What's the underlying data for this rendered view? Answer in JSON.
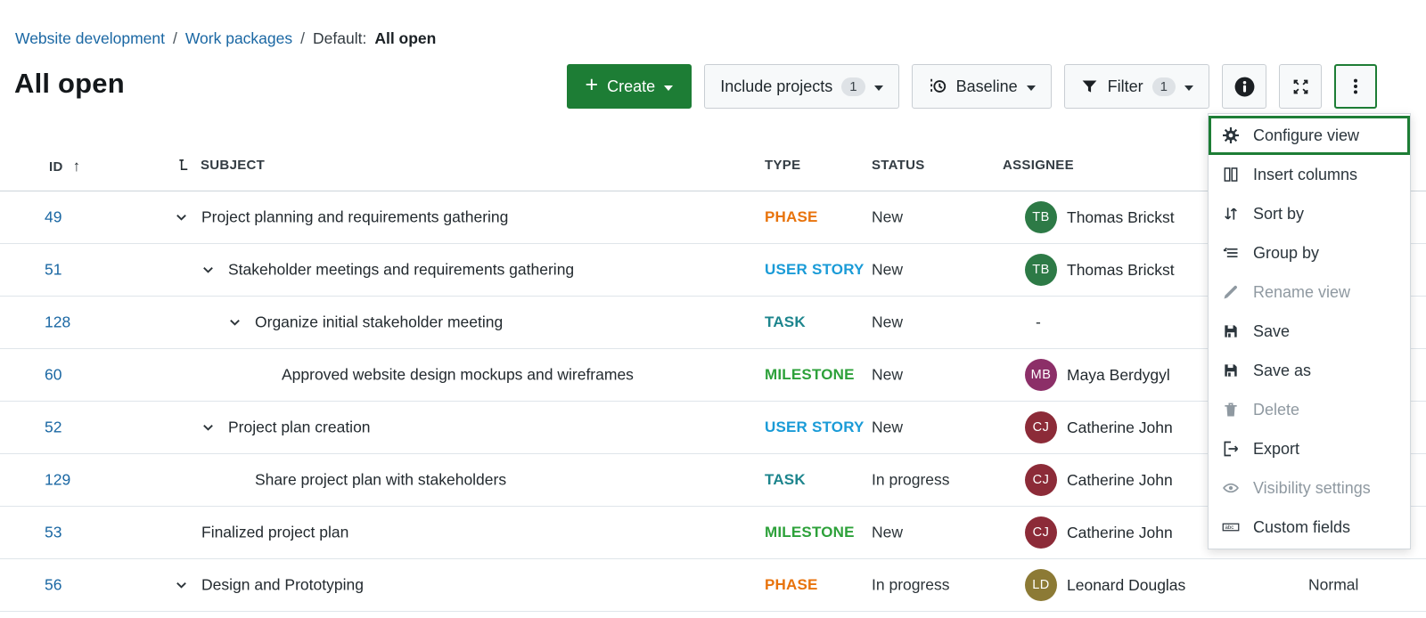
{
  "breadcrumb": {
    "separator": "/",
    "project": "Website development",
    "section": "Work packages",
    "default_prefix": "Default:",
    "current_view": "All open"
  },
  "page": {
    "title": "All open"
  },
  "toolbar": {
    "create_button": {
      "plus": "+",
      "label": "Create"
    },
    "include_projects_button": {
      "label": "Include projects",
      "count": "1"
    },
    "baseline_button": {
      "label": "Baseline",
      "icon": "baseline-clock-icon"
    },
    "filter_button": {
      "label": "Filter",
      "count": "1",
      "icon": "funnel-icon"
    },
    "info_button": {
      "icon": "info-icon"
    },
    "fullscreen_button": {
      "icon": "fullscreen-icon"
    },
    "more_button": {
      "icon": "kebab-menu-icon",
      "state": "focused"
    }
  },
  "menu": {
    "items": [
      {
        "label": "Configure view",
        "icon": "gear-icon",
        "state": "focused"
      },
      {
        "label": "Insert columns",
        "icon": "columns-icon",
        "state": "normal"
      },
      {
        "label": "Sort by",
        "icon": "sort-arrows-icon",
        "state": "normal"
      },
      {
        "label": "Group by",
        "icon": "group-by-icon",
        "state": "normal"
      },
      {
        "label": "Rename view",
        "icon": "pencil-icon",
        "state": "disabled"
      },
      {
        "label": "Save",
        "icon": "save-icon",
        "state": "normal"
      },
      {
        "label": "Save as",
        "icon": "save-icon",
        "state": "normal"
      },
      {
        "label": "Delete",
        "icon": "trash-icon",
        "state": "disabled"
      },
      {
        "label": "Export",
        "icon": "export-icon",
        "state": "normal"
      },
      {
        "label": "Visibility settings",
        "icon": "eye-icon",
        "state": "disabled"
      },
      {
        "label": "Custom fields",
        "icon": "abc-icon",
        "state": "normal"
      }
    ]
  },
  "table": {
    "headers": {
      "id": "ID",
      "subject": "SUBJECT",
      "type": "TYPE",
      "status": "STATUS",
      "assignee": "ASSIGNEE"
    },
    "sort": {
      "column": "ID",
      "direction": "asc",
      "arrow": "↑"
    },
    "rows": [
      {
        "id": "49",
        "level": 1,
        "expanded": true,
        "subject": "Project planning and requirements gathering",
        "type": "PHASE",
        "type_color": "#e8730c",
        "status": "New",
        "assignee": {
          "initials": "TB",
          "name": "Thomas Brickst",
          "color": "#2d7a46"
        }
      },
      {
        "id": "51",
        "level": 2,
        "expanded": true,
        "subject": "Stakeholder meetings and requirements gathering",
        "type": "USER STORY",
        "type_color": "#1a9bd7",
        "status": "New",
        "assignee": {
          "initials": "TB",
          "name": "Thomas Brickst",
          "color": "#2d7a46"
        }
      },
      {
        "id": "128",
        "level": 3,
        "expanded": true,
        "subject": "Organize initial stakeholder meeting",
        "type": "TASK",
        "type_color": "#1d858d",
        "status": "New",
        "assignee_empty": "-"
      },
      {
        "id": "60",
        "level": 4,
        "expanded": false,
        "subject": "Approved website design mockups and wireframes",
        "type": "MILESTONE",
        "type_color": "#2da13a",
        "status": "New",
        "assignee": {
          "initials": "MB",
          "name": "Maya Berdygyl",
          "color": "#8c2f68"
        }
      },
      {
        "id": "52",
        "level": 2,
        "expanded": true,
        "subject": "Project plan creation",
        "type": "USER STORY",
        "type_color": "#1a9bd7",
        "status": "New",
        "assignee": {
          "initials": "CJ",
          "name": "Catherine John",
          "color": "#8c2b38"
        }
      },
      {
        "id": "129",
        "level": 3,
        "expanded": false,
        "subject": "Share project plan with stakeholders",
        "type": "TASK",
        "type_color": "#1d858d",
        "status": "In progress",
        "assignee": {
          "initials": "CJ",
          "name": "Catherine John",
          "color": "#8c2b38"
        }
      },
      {
        "id": "53",
        "level": 1,
        "expanded": false,
        "subject": "Finalized project plan",
        "type": "MILESTONE",
        "type_color": "#2da13a",
        "status": "New",
        "assignee": {
          "initials": "CJ",
          "name": "Catherine John",
          "color": "#8c2b38"
        }
      },
      {
        "id": "56",
        "level": 1,
        "expanded": true,
        "subject": "Design and Prototyping",
        "type": "PHASE",
        "type_color": "#e8730c",
        "status": "In progress",
        "assignee": {
          "initials": "LD",
          "name": "Leonard Douglas",
          "color": "#8c7a35"
        },
        "priority": "Normal"
      }
    ]
  },
  "colors": {
    "accent_green": "#1d7d35",
    "link_blue": "#1a67a3",
    "type_phase": "#e8730c",
    "type_user_story": "#1a9bd7",
    "type_task": "#1d858d",
    "type_milestone": "#2da13a",
    "row_divider": "#dfe5ea",
    "button_bg": "#f7f9fa",
    "button_border": "#c9ced3",
    "badge_bg": "#dee2e6"
  }
}
